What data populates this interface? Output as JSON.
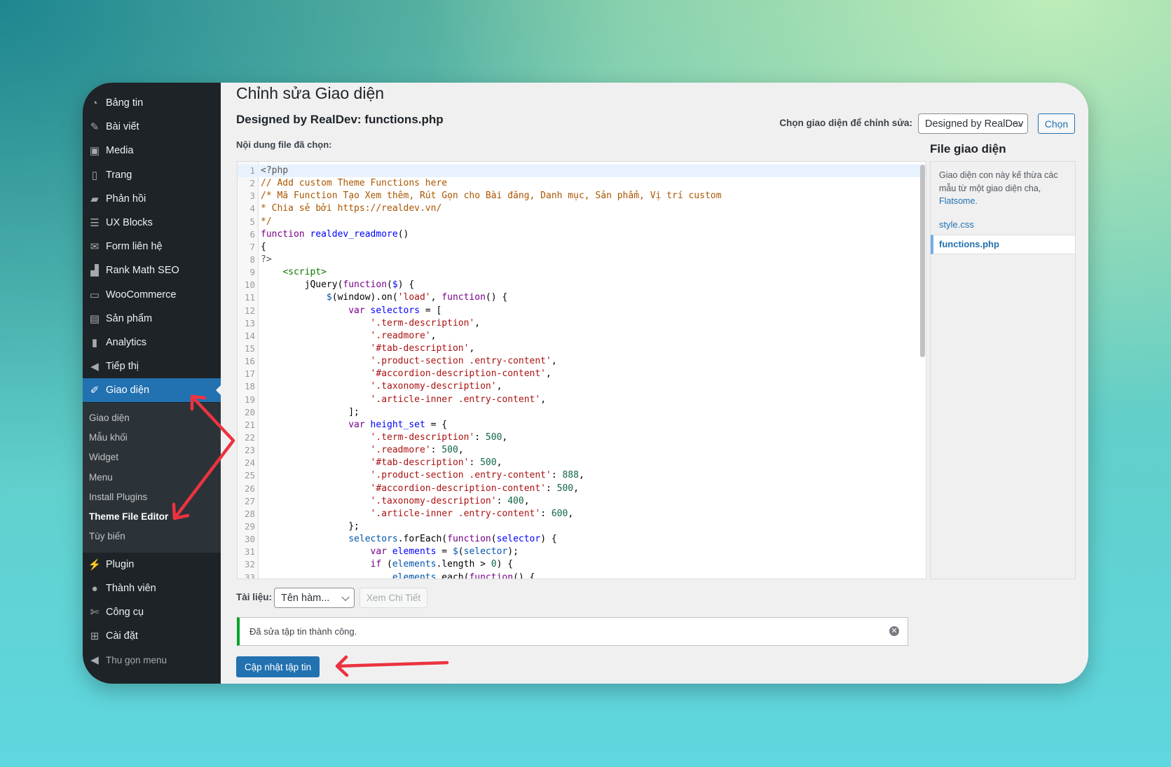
{
  "page": {
    "title": "Chỉnh sửa Giao diện",
    "file_heading": "Designed by RealDev: functions.php",
    "content_label": "Nội dung file đã chọn:"
  },
  "theme_select": {
    "label": "Chọn giao diện để chỉnh sửa:",
    "value": "Designed by RealDev",
    "button": "Chọn"
  },
  "sidebar": {
    "items": [
      {
        "label": "Bảng tin",
        "icon": "dashboard-icon"
      },
      {
        "label": "Bài viết",
        "icon": "pin-icon"
      },
      {
        "label": "Media",
        "icon": "media-icon"
      },
      {
        "label": "Trang",
        "icon": "page-icon"
      },
      {
        "label": "Phản hồi",
        "icon": "comment-icon"
      },
      {
        "label": "UX Blocks",
        "icon": "blocks-icon"
      },
      {
        "label": "Form liên hệ",
        "icon": "mail-icon"
      },
      {
        "label": "Rank Math SEO",
        "icon": "rankmath-icon"
      },
      {
        "label": "WooCommerce",
        "icon": "woo-icon"
      },
      {
        "label": "Sản phẩm",
        "icon": "archive-icon"
      },
      {
        "label": "Analytics",
        "icon": "bar-chart-icon"
      },
      {
        "label": "Tiếp thị",
        "icon": "megaphone-icon"
      },
      {
        "label": "Giao diện",
        "icon": "brush-icon",
        "active": true
      }
    ],
    "submenu": [
      {
        "label": "Giao diện"
      },
      {
        "label": "Mẫu khối"
      },
      {
        "label": "Widget"
      },
      {
        "label": "Menu"
      },
      {
        "label": "Install Plugins"
      },
      {
        "label": "Theme File Editor",
        "current": true
      },
      {
        "label": "Tùy biến"
      }
    ],
    "items_after": [
      {
        "label": "Plugin",
        "icon": "plugin-icon"
      },
      {
        "label": "Thành viên",
        "icon": "user-icon"
      },
      {
        "label": "Công cụ",
        "icon": "wrench-icon"
      },
      {
        "label": "Cài đặt",
        "icon": "settings-icon"
      }
    ],
    "collapse": "Thu gọn menu"
  },
  "files_panel": {
    "title": "File giao diện",
    "note": "Giao diện con này kế thừa các mẫu từ một giao diện cha, ",
    "parent": "Flatsome",
    "note_end": ".",
    "files": [
      "style.css",
      "functions.php"
    ],
    "active_file": "functions.php"
  },
  "docs": {
    "label": "Tài liệu:",
    "select_value": "Tên hàm...",
    "lookup": "Xem Chi Tiết"
  },
  "notice": {
    "text": "Đã sửa tập tin thành công.",
    "color": "#00a32a"
  },
  "update_button": "Cập nhật tập tin",
  "colors": {
    "accent": "#2271b1",
    "sidebar": "#1d2327",
    "annotation": "#e8323c"
  },
  "code": [
    [
      [
        "<?php",
        "meta"
      ]
    ],
    [
      [
        "// Add custom Theme Functions here",
        "comment"
      ]
    ],
    [
      [
        "/* Mã Function Tạo Xem thêm, Rút Gọn cho Bài đăng, Danh mục, Sản phẩm, Vị trí custom",
        "comment"
      ]
    ],
    [
      [
        "* Chia sẻ bởi https://realdev.vn/",
        "comment"
      ]
    ],
    [
      [
        "*/",
        "comment"
      ]
    ],
    [
      [
        "function",
        "keyword"
      ],
      [
        " ",
        ""
      ],
      [
        "realdev_readmore",
        "def"
      ],
      [
        "()",
        ""
      ]
    ],
    [
      [
        "{",
        ""
      ]
    ],
    [
      [
        "?>",
        "meta"
      ]
    ],
    [
      [
        "    ",
        ""
      ],
      [
        "<script>",
        "tag"
      ]
    ],
    [
      [
        "        jQuery(",
        ""
      ],
      [
        "function",
        "keyword"
      ],
      [
        "(",
        ""
      ],
      [
        "$",
        "def"
      ],
      [
        ") {",
        ""
      ]
    ],
    [
      [
        "            ",
        ""
      ],
      [
        "$",
        "var"
      ],
      [
        "(window).on(",
        ""
      ],
      [
        "'load'",
        "string"
      ],
      [
        ", ",
        ""
      ],
      [
        "function",
        "keyword"
      ],
      [
        "() {",
        ""
      ]
    ],
    [
      [
        "                ",
        ""
      ],
      [
        "var",
        "keyword"
      ],
      [
        " ",
        ""
      ],
      [
        "selectors",
        "def"
      ],
      [
        " = [",
        ""
      ]
    ],
    [
      [
        "                    ",
        ""
      ],
      [
        "'.term-description'",
        "string"
      ],
      [
        ",",
        ""
      ]
    ],
    [
      [
        "                    ",
        ""
      ],
      [
        "'.readmore'",
        "string"
      ],
      [
        ",",
        ""
      ]
    ],
    [
      [
        "                    ",
        ""
      ],
      [
        "'#tab-description'",
        "string"
      ],
      [
        ",",
        ""
      ]
    ],
    [
      [
        "                    ",
        ""
      ],
      [
        "'.product-section .entry-content'",
        "string"
      ],
      [
        ",",
        ""
      ]
    ],
    [
      [
        "                    ",
        ""
      ],
      [
        "'#accordion-description-content'",
        "string"
      ],
      [
        ",",
        ""
      ]
    ],
    [
      [
        "                    ",
        ""
      ],
      [
        "'.taxonomy-description'",
        "string"
      ],
      [
        ",",
        ""
      ]
    ],
    [
      [
        "                    ",
        ""
      ],
      [
        "'.article-inner .entry-content'",
        "string"
      ],
      [
        ",",
        ""
      ]
    ],
    [
      [
        "                ];",
        ""
      ]
    ],
    [
      [
        "                ",
        ""
      ],
      [
        "var",
        "keyword"
      ],
      [
        " ",
        ""
      ],
      [
        "height_set",
        "def"
      ],
      [
        " = {",
        ""
      ]
    ],
    [
      [
        "                    ",
        ""
      ],
      [
        "'.term-description'",
        "string"
      ],
      [
        ": ",
        ""
      ],
      [
        "500",
        "number"
      ],
      [
        ",",
        ""
      ]
    ],
    [
      [
        "                    ",
        ""
      ],
      [
        "'.readmore'",
        "string"
      ],
      [
        ": ",
        ""
      ],
      [
        "500",
        "number"
      ],
      [
        ",",
        ""
      ]
    ],
    [
      [
        "                    ",
        ""
      ],
      [
        "'#tab-description'",
        "string"
      ],
      [
        ": ",
        ""
      ],
      [
        "500",
        "number"
      ],
      [
        ",",
        ""
      ]
    ],
    [
      [
        "                    ",
        ""
      ],
      [
        "'.product-section .entry-content'",
        "string"
      ],
      [
        ": ",
        ""
      ],
      [
        "888",
        "number"
      ],
      [
        ",",
        ""
      ]
    ],
    [
      [
        "                    ",
        ""
      ],
      [
        "'#accordion-description-content'",
        "string"
      ],
      [
        ": ",
        ""
      ],
      [
        "500",
        "number"
      ],
      [
        ",",
        ""
      ]
    ],
    [
      [
        "                    ",
        ""
      ],
      [
        "'.taxonomy-description'",
        "string"
      ],
      [
        ": ",
        ""
      ],
      [
        "400",
        "number"
      ],
      [
        ",",
        ""
      ]
    ],
    [
      [
        "                    ",
        ""
      ],
      [
        "'.article-inner .entry-content'",
        "string"
      ],
      [
        ": ",
        ""
      ],
      [
        "600",
        "number"
      ],
      [
        ",",
        ""
      ]
    ],
    [
      [
        "                };",
        ""
      ]
    ],
    [
      [
        "                ",
        ""
      ],
      [
        "selectors",
        "var"
      ],
      [
        ".forEach(",
        ""
      ],
      [
        "function",
        "keyword"
      ],
      [
        "(",
        ""
      ],
      [
        "selector",
        "def"
      ],
      [
        ") {",
        ""
      ]
    ],
    [
      [
        "                    ",
        ""
      ],
      [
        "var",
        "keyword"
      ],
      [
        " ",
        ""
      ],
      [
        "elements",
        "def"
      ],
      [
        " = ",
        ""
      ],
      [
        "$",
        "var"
      ],
      [
        "(",
        ""
      ],
      [
        "selector",
        "var"
      ],
      [
        ");",
        ""
      ]
    ],
    [
      [
        "                    ",
        ""
      ],
      [
        "if",
        "keyword"
      ],
      [
        " (",
        ""
      ],
      [
        "elements",
        "var"
      ],
      [
        ".length > ",
        ""
      ],
      [
        "0",
        "number"
      ],
      [
        ") {",
        ""
      ]
    ],
    [
      [
        "                        ",
        ""
      ],
      [
        "elements",
        "var"
      ],
      [
        ".each(",
        ""
      ],
      [
        "function",
        "keyword"
      ],
      [
        "() {",
        ""
      ]
    ]
  ]
}
